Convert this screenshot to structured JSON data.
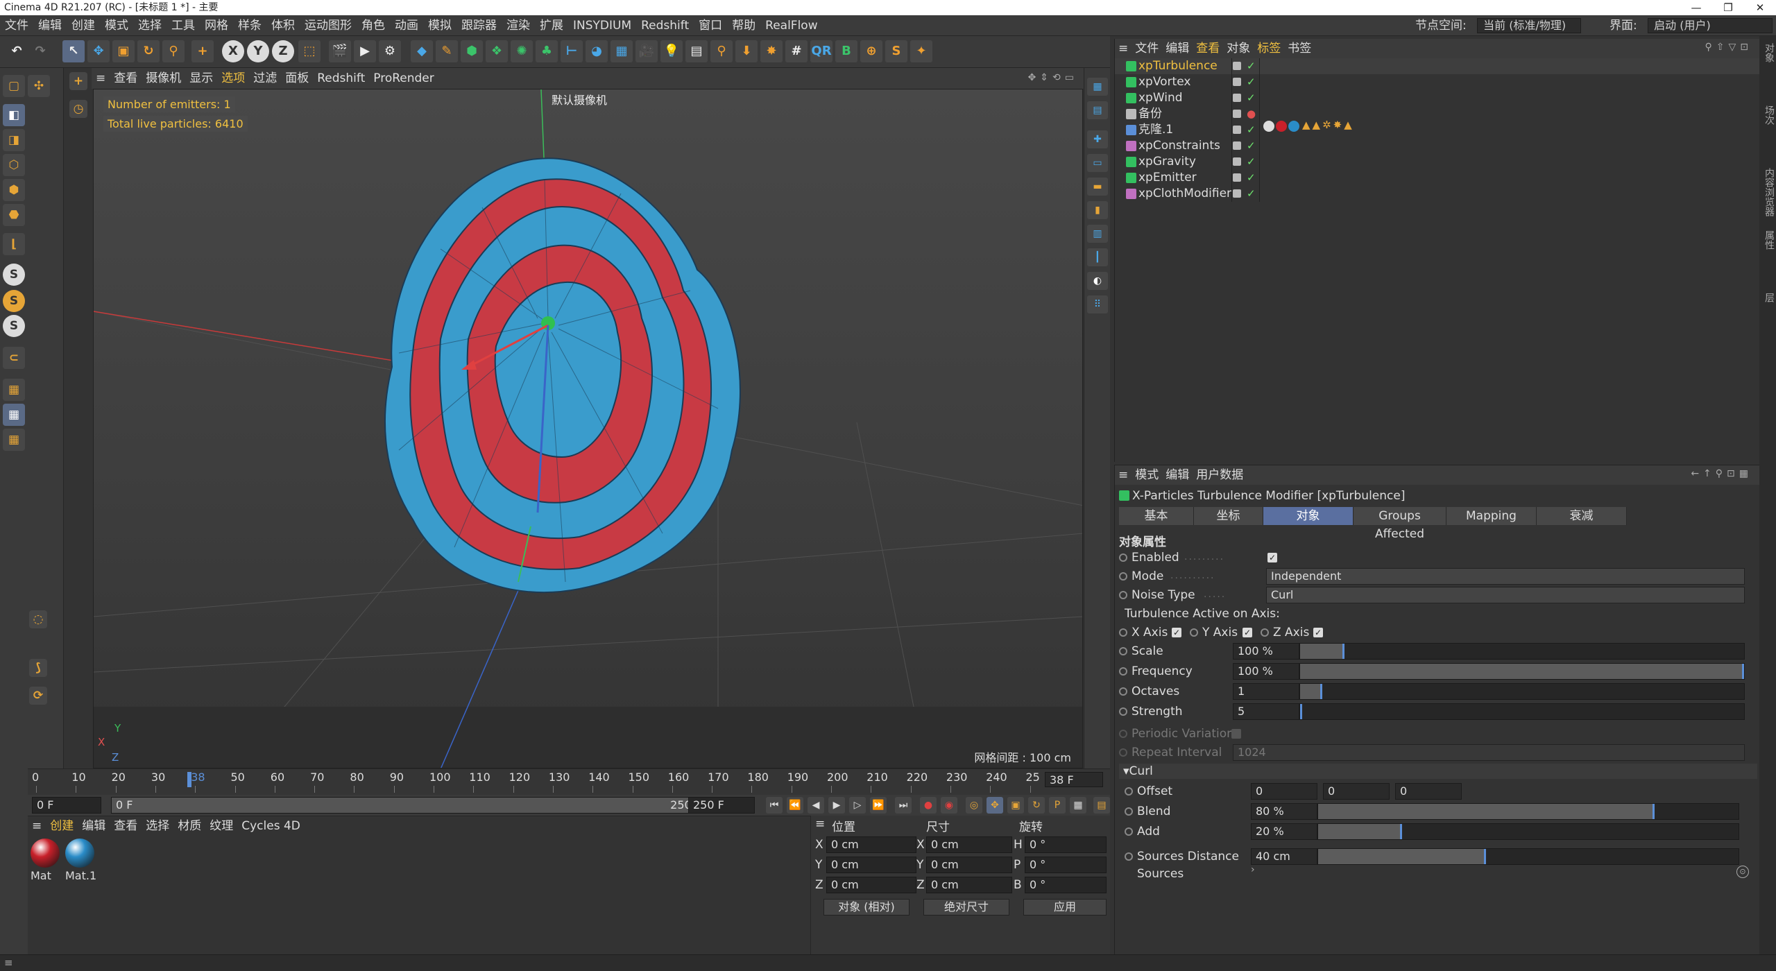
{
  "window": {
    "title": "Cinema 4D R21.207 (RC) - [未标题 1 *] - 主要"
  },
  "menubar": {
    "items": [
      "文件",
      "编辑",
      "创建",
      "模式",
      "选择",
      "工具",
      "网格",
      "样条",
      "体积",
      "运动图形",
      "角色",
      "动画",
      "模拟",
      "跟踪器",
      "渲染",
      "扩展",
      "INSYDIUM",
      "Redshift",
      "窗口",
      "帮助",
      "RealFlow"
    ],
    "node_space_label": "节点空间:",
    "node_space_value": "当前 (标准/物理)",
    "layout_label": "界面:",
    "layout_value": "启动 (用户)"
  },
  "viewport": {
    "menu": [
      "查看",
      "摄像机",
      "显示",
      "选项",
      "过滤",
      "面板",
      "Redshift",
      "ProRender"
    ],
    "camera": "默认摄像机",
    "hud_emitters": "Number of emitters: 1",
    "hud_particles": "Total live particles: 6410",
    "grid_spacing": "网格间距 : 100 cm",
    "axis_x": "X",
    "axis_y": "Y",
    "axis_z": "Z"
  },
  "timeline": {
    "ticks": [
      "0",
      "10",
      "20",
      "30",
      "38",
      "50",
      "60",
      "70",
      "80",
      "90",
      "100",
      "110",
      "120",
      "130",
      "140",
      "150",
      "160",
      "170",
      "180",
      "190",
      "200",
      "210",
      "220",
      "230",
      "240",
      "25"
    ],
    "current_frame_display": "38 F",
    "current_frame": 38,
    "start_field": "0 F",
    "range_start": "0 F",
    "range_end": "250 F",
    "end_field": "250 F"
  },
  "materials": {
    "menu": [
      "创建",
      "编辑",
      "查看",
      "选择",
      "材质",
      "纹理",
      "Cycles 4D"
    ],
    "items": [
      {
        "name": "Mat",
        "color": "#c8202a"
      },
      {
        "name": "Mat.1",
        "color": "#2a8cc8"
      }
    ]
  },
  "coordinates": {
    "headers": {
      "position": "位置",
      "size": "尺寸",
      "rotation": "旋转"
    },
    "rows": [
      {
        "axis": "X",
        "pos": "0 cm",
        "size_axis": "X",
        "size": "0 cm",
        "rot_axis": "H",
        "rot": "0 °"
      },
      {
        "axis": "Y",
        "pos": "0 cm",
        "size_axis": "Y",
        "size": "0 cm",
        "rot_axis": "P",
        "rot": "0 °"
      },
      {
        "axis": "Z",
        "pos": "0 cm",
        "size_axis": "Z",
        "size": "0 cm",
        "rot_axis": "B",
        "rot": "0 °"
      }
    ],
    "mode_dropdown": "对象 (相对)",
    "size_dropdown": "绝对尺寸",
    "apply_button": "应用"
  },
  "object_manager": {
    "menu": [
      "文件",
      "编辑",
      "查看",
      "对象",
      "标签",
      "书签"
    ],
    "objects": [
      {
        "name": "xpTurbulence",
        "selected": true,
        "icon_color": "#33c060",
        "enabled": true
      },
      {
        "name": "xpVortex",
        "selected": false,
        "icon_color": "#33c060",
        "enabled": true
      },
      {
        "name": "xpWind",
        "selected": false,
        "icon_color": "#33c060",
        "enabled": true
      },
      {
        "name": "备份",
        "selected": false,
        "icon_color": "#bbbbbb",
        "enabled": false
      },
      {
        "name": "克隆.1",
        "selected": false,
        "icon_color": "#5b8fd8",
        "enabled": true
      },
      {
        "name": "xpConstraints",
        "selected": false,
        "icon_color": "#c070c0",
        "enabled": true
      },
      {
        "name": "xpGravity",
        "selected": false,
        "icon_color": "#33c060",
        "enabled": true
      },
      {
        "name": "xpEmitter",
        "selected": false,
        "icon_color": "#33c060",
        "enabled": true
      },
      {
        "name": "xpClothModifier",
        "selected": false,
        "icon_color": "#c070c0",
        "enabled": true
      }
    ]
  },
  "attributes": {
    "menu": [
      "模式",
      "编辑",
      "用户数据"
    ],
    "title": "X-Particles Turbulence Modifier [xpTurbulence]",
    "tabs": [
      "基本",
      "坐标",
      "对象",
      "Groups Affected",
      "Mapping",
      "衰减"
    ],
    "active_tab": "对象",
    "section_title": "对象属性",
    "enabled_label": "Enabled",
    "mode_label": "Mode",
    "mode_value": "Independent",
    "noise_type_label": "Noise Type",
    "noise_type_value": "Curl",
    "axis_group_label": "Turbulence Active on Axis:",
    "x_axis_label": "X Axis",
    "y_axis_label": "Y Axis",
    "z_axis_label": "Z Axis",
    "scale_label": "Scale",
    "scale_value": "100 %",
    "scale_level": 0.1,
    "frequency_label": "Frequency",
    "frequency_value": "100 %",
    "frequency_level": 1.0,
    "octaves_label": "Octaves",
    "octaves_value": "1",
    "octaves_level": 0.05,
    "strength_label": "Strength",
    "strength_value": "5",
    "strength_level": 0.0,
    "periodic_label": "Periodic Variation",
    "repeat_label": "Repeat Interval",
    "repeat_value": "1024",
    "curl_section": "Curl",
    "offset_label": "Offset",
    "offset_values": [
      "0",
      "0",
      "0"
    ],
    "blend_label": "Blend",
    "blend_value": "80 %",
    "blend_level": 0.8,
    "add_label": "Add",
    "add_value": "20 %",
    "add_level": 0.2,
    "sources_distance_label": "Sources Distance",
    "sources_distance_value": "40 cm",
    "sources_distance_level": 0.4,
    "sources_label": "Sources"
  },
  "right_strip": [
    "对象",
    "场次",
    "内容浏览器",
    "属性",
    "层"
  ],
  "colors": {
    "accent": "#5b8fd8",
    "hud": "#f0c040",
    "selected_obj": "#f0c040"
  }
}
